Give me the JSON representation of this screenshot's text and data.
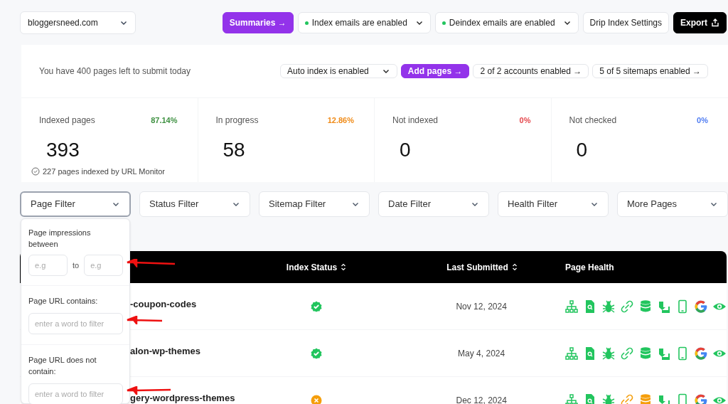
{
  "site_selector": {
    "value": "bloggersneed.com"
  },
  "top_actions": [
    {
      "kind": "primary",
      "label": "Summaries →"
    },
    {
      "kind": "status_dropdown",
      "label": "Index emails are enabled",
      "color": "#22c55e"
    },
    {
      "kind": "status_dropdown",
      "label": "Deindex emails are enabled",
      "color": "#22c55e"
    },
    {
      "kind": "plain",
      "label": "Drip Index Settings"
    },
    {
      "kind": "dark",
      "label": "Export"
    }
  ],
  "quota_text": "You have 400 pages left to submit today",
  "toolbar_buttons": [
    {
      "kind": "dropdown",
      "label": "Auto index is enabled"
    },
    {
      "kind": "primary",
      "label": "Add pages →"
    },
    {
      "kind": "plain",
      "label": "2 of 2 accounts enabled →"
    },
    {
      "kind": "plain",
      "label": "5 of 5 sitemaps enabled →"
    }
  ],
  "stats": [
    {
      "label": "Indexed pages",
      "percent": "87.14%",
      "color": "#3f9142",
      "value": "393",
      "note": "227 pages indexed by URL Monitor"
    },
    {
      "label": "In progress",
      "percent": "12.86%",
      "color": "#f08c1a",
      "value": "58"
    },
    {
      "label": "Not indexed",
      "percent": "0%",
      "color": "#e5484d",
      "value": "0"
    },
    {
      "label": "Not checked",
      "percent": "0%",
      "color": "#4f7cf2",
      "value": "0"
    }
  ],
  "filters": [
    {
      "label": "Page Filter",
      "selected": true
    },
    {
      "label": "Status Filter",
      "selected": false
    },
    {
      "label": "Sitemap Filter",
      "selected": false
    },
    {
      "label": "Date Filter",
      "selected": false
    },
    {
      "label": "Health Filter",
      "selected": false
    },
    {
      "label": "More Pages",
      "selected": false
    }
  ],
  "page_filter_panel": {
    "impressions": {
      "label": "Page impressions between",
      "from_placeholder": "e.g",
      "separator": "to",
      "to_placeholder": "e.g"
    },
    "contains": {
      "label": "Page URL contains:",
      "placeholder": "enter a word to filter"
    },
    "not_contains": {
      "label": "Page URL does not contain:",
      "placeholder": "enter a word to filter"
    }
  },
  "table": {
    "columns": [
      {
        "label": "Index Status",
        "sortable": true
      },
      {
        "label": "Last Submitted",
        "sortable": true
      },
      {
        "label": "Page Health",
        "sortable": false
      }
    ],
    "rows": [
      {
        "url": "-coupon-codes",
        "indexed": true,
        "last_submitted": "Nov 12, 2024",
        "health": [
          {
            "warning": false
          },
          {
            "warning": false
          },
          {
            "warning": false
          },
          {
            "warning": false
          },
          {
            "warning": false
          },
          {
            "warning": false
          },
          {
            "warning": false
          },
          {
            "warning": false
          },
          {
            "warning": false
          }
        ]
      },
      {
        "url": "alon-wp-themes",
        "indexed": true,
        "last_submitted": "May 4, 2024",
        "health": [
          {
            "warning": false
          },
          {
            "warning": false
          },
          {
            "warning": false
          },
          {
            "warning": false
          },
          {
            "warning": false
          },
          {
            "warning": false
          },
          {
            "warning": false
          },
          {
            "warning": false
          },
          {
            "warning": false
          }
        ]
      },
      {
        "url": "gery-wordpress-themes",
        "indexed": false,
        "last_submitted": "Dec 12, 2024",
        "health": [
          {
            "warning": false
          },
          {
            "warning": false
          },
          {
            "warning": false
          },
          {
            "warning": true
          },
          {
            "warning": true
          },
          {
            "warning": false
          },
          {
            "warning": false
          },
          {
            "warning": false
          },
          {
            "warning": false
          }
        ]
      }
    ]
  }
}
